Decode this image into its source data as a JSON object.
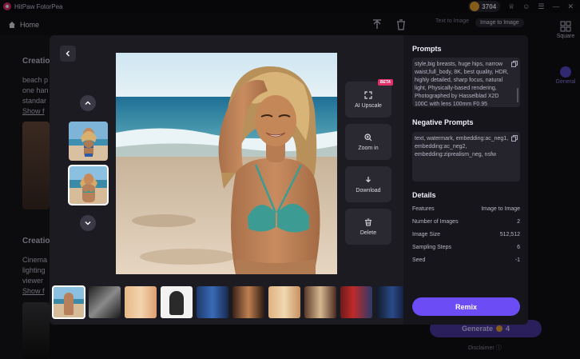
{
  "app": {
    "title": "HitPaw FotorPea",
    "coins": "3704",
    "nav_home": "Home",
    "tab_text_to_image": "Text to Image",
    "tab_image_to_image": "Image to Image",
    "right_square": "Square",
    "right_general": "General",
    "generate_label": "Generate",
    "generate_cost": "4",
    "disclaimer": "Disclaimer"
  },
  "background": {
    "creation_1": "Creatio",
    "creation_1_text": [
      "beach p",
      "one han",
      "standar",
      "Show f"
    ],
    "creation_2": "Creatio",
    "creation_2_text": [
      "Cinema",
      "lighting",
      "viewer",
      "Show f"
    ]
  },
  "modal": {
    "tools": [
      {
        "name": "ai-upscale",
        "label": "AI Upscale",
        "badge": "BETA"
      },
      {
        "name": "zoom-in",
        "label": "Zoom in"
      },
      {
        "name": "download",
        "label": "Download"
      },
      {
        "name": "delete",
        "label": "Delete"
      }
    ],
    "prompts_title": "Prompts",
    "prompts_text": "style,big breasts, huge hips, narrow waist,full_body, 8K, best quality, HDR, highly detailed, sharp focus, natural light, Physically-based rendering, Photographed by Hasselblad X2D 100C with lens 100mm F0.95",
    "negative_title": "Negative Prompts",
    "negative_text": "text, watermark, embedding:ac_neg1, embedding:ac_neg2, embedding:ziprealism_neg, nsfw",
    "details_title": "Details",
    "details": [
      {
        "label": "Features",
        "value": "Image to Image"
      },
      {
        "label": "Number of Images",
        "value": "2"
      },
      {
        "label": "Image Size",
        "value": "512,512"
      },
      {
        "label": "Sampling Steps",
        "value": "6"
      },
      {
        "label": "Seed",
        "value": "-1"
      }
    ],
    "remix_label": "Remix"
  }
}
